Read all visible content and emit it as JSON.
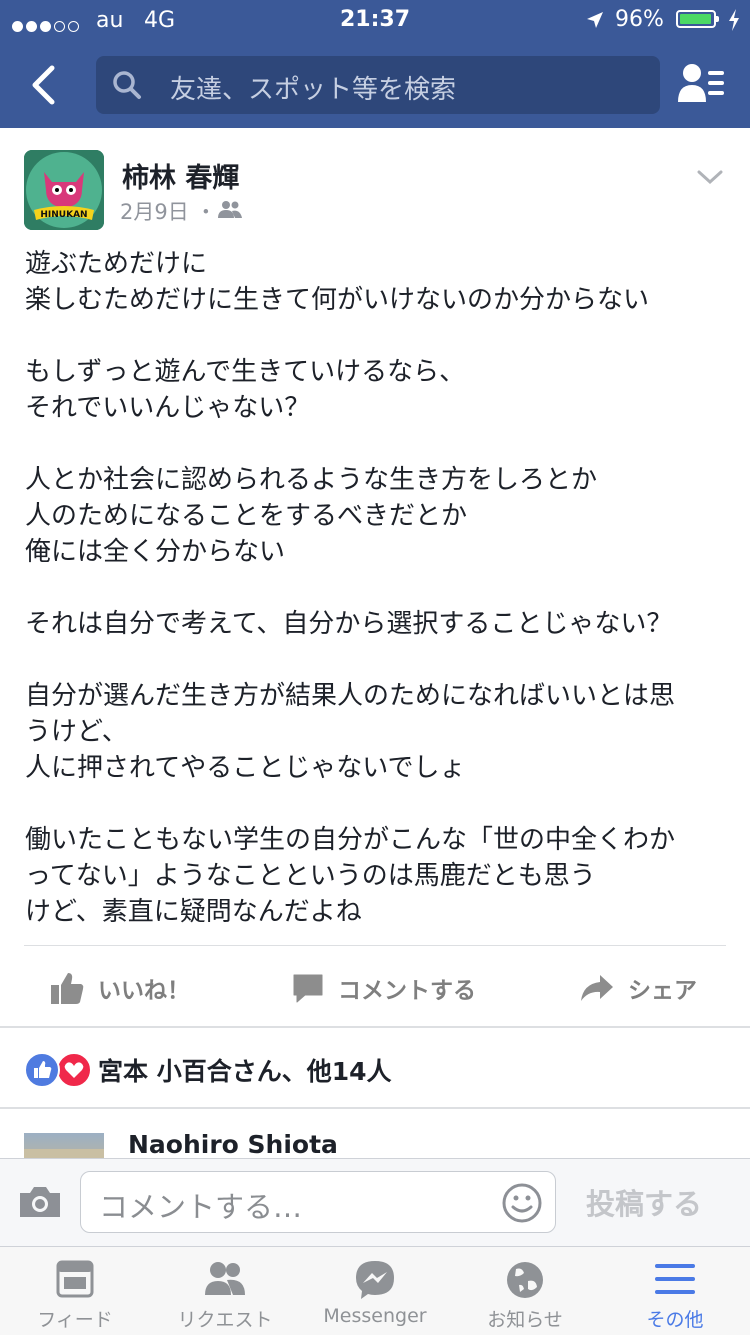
{
  "status_bar": {
    "carrier": "au",
    "network": "4G",
    "time": "21:37",
    "battery": "96%"
  },
  "header": {
    "search_placeholder": "友達、スポット等を検索"
  },
  "post": {
    "author": "柿林 春輝",
    "date": "2月9日 ・",
    "paragraphs": [
      "遊ぶためだけに\n楽しむためだけに生きて何がいけないのか分からない",
      "もしずっと遊んで生きていけるなら、\nそれでいいんじゃない？",
      "人とか社会に認められるような生き方をしろとか\n人のためになることをするべきだとか\n俺には全く分からない",
      "それは自分で考えて、自分から選択することじゃない？",
      "自分が選んだ生き方が結果人のためになればいいとは思\nうけど、\n人に押されてやることじゃないでしょ",
      "働いたこともない学生の自分がこんな「世の中全くわか\nってない」ようなことというのは馬鹿だとも思う\nけど、素直に疑問なんだよね"
    ],
    "actions": {
      "like": "いいね！",
      "comment": "コメントする",
      "share": "シェア"
    },
    "reactions_text": "宮本 小百合さん、他14人",
    "avatar_text": "HINUKAN"
  },
  "comment_preview": {
    "name": "Naohiro Shiota"
  },
  "comment_bar": {
    "placeholder": "コメントする…",
    "post_label": "投稿する"
  },
  "tabs": [
    {
      "label": "フィード",
      "icon": "feed-icon"
    },
    {
      "label": "リクエスト",
      "icon": "friend-requests-icon"
    },
    {
      "label": "Messenger",
      "icon": "messenger-icon"
    },
    {
      "label": "お知らせ",
      "icon": "notifications-globe-icon"
    },
    {
      "label": "その他",
      "icon": "more-menu-icon",
      "active": true
    }
  ],
  "colors": {
    "brand": "#3b5998",
    "active_tab": "#4a7ae6",
    "like_blue": "#4f7be0",
    "love_red": "#f0284a",
    "battery_green": "#4cd964"
  }
}
